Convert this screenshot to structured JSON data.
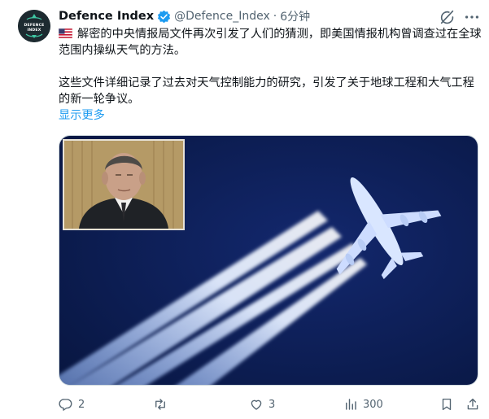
{
  "tweet": {
    "display_name": "Defence Index",
    "handle": "@Defence_Index",
    "separator": "·",
    "time": "6分钟",
    "avatar_text": [
      "DEFENCE",
      "INDEX"
    ],
    "flag": "us-flag-icon",
    "paragraph1": "解密的中央情报局文件再次引发了人们的猜测，即美国情报机构曾调查过在全球范围内操纵天气的方法。",
    "paragraph2": "这些文件详细记录了过去对天气控制能力的研究，引发了关于地球工程和大气工程的新一轮争议。",
    "show_more": "显示更多"
  },
  "media": {
    "description_icons": [
      "contrails-photo",
      "portrait-inset"
    ]
  },
  "actions": {
    "reply_count": "2",
    "retweet_count": "",
    "like_count": "3",
    "views_count": "300"
  },
  "colors": {
    "accent": "#1d9bf0",
    "muted": "#536471",
    "text": "#0f1419",
    "sky": "#0c1c52"
  }
}
